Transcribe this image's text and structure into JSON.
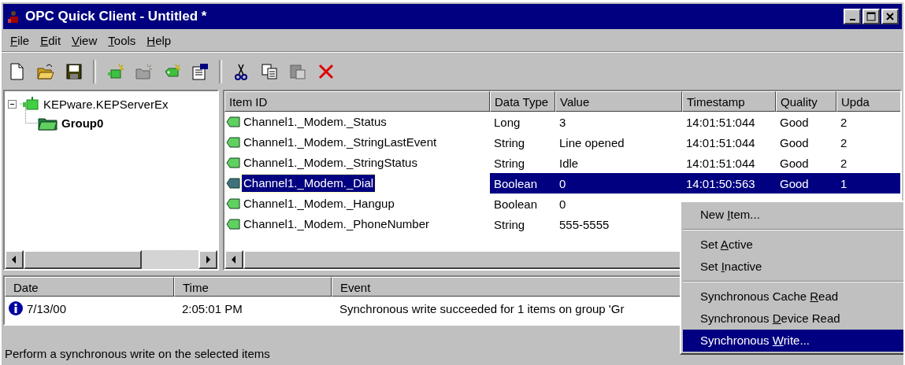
{
  "window": {
    "title": "OPC Quick Client - Untitled *"
  },
  "menu_bar": [
    {
      "key": "F",
      "rest": "ile"
    },
    {
      "key": "E",
      "rest": "dit"
    },
    {
      "key": "V",
      "rest": "iew"
    },
    {
      "key": "T",
      "rest": "ools"
    },
    {
      "key": "H",
      "rest": "elp"
    }
  ],
  "tree": [
    {
      "label": "KEPware.KEPServerEx",
      "expanded": true,
      "selected": false,
      "children": [
        {
          "label": "Group0",
          "selected": true
        }
      ]
    }
  ],
  "item_table": {
    "columns": [
      "Item ID",
      "Data Type",
      "Value",
      "Timestamp",
      "Quality",
      "Upda"
    ],
    "rows": [
      {
        "cells": [
          "Channel1._Modem._Status",
          "Long",
          "3",
          "14:01:51:044",
          "Good",
          "2"
        ],
        "selected": false
      },
      {
        "cells": [
          "Channel1._Modem._StringLastEvent",
          "String",
          "Line opened",
          "14:01:51:044",
          "Good",
          "2"
        ],
        "selected": false
      },
      {
        "cells": [
          "Channel1._Modem._StringStatus",
          "String",
          "Idle",
          "14:01:51:044",
          "Good",
          "2"
        ],
        "selected": false
      },
      {
        "cells": [
          "Channel1._Modem._Dial",
          "Boolean",
          "0",
          "14:01:50:563",
          "Good",
          "1"
        ],
        "selected": true
      },
      {
        "cells": [
          "Channel1._Modem._Hangup",
          "Boolean",
          "0"
        ],
        "selected": false
      },
      {
        "cells": [
          "Channel1._Modem._PhoneNumber",
          "String",
          "555-5555"
        ],
        "selected": false
      }
    ]
  },
  "event_log": {
    "columns": [
      "Date",
      "Time",
      "Event"
    ],
    "rows": [
      {
        "kind": "info",
        "cells": [
          "7/13/00",
          "2:05:01 PM",
          "Synchronous write succeeded for 1 items on group 'Gr"
        ]
      }
    ]
  },
  "status_bar": "Perform a synchronous write on the selected items",
  "context_menu": [
    {
      "kind": "item",
      "pre": "New ",
      "key": "I",
      "rest": "tem...",
      "selected": false
    },
    {
      "kind": "separator"
    },
    {
      "kind": "item",
      "pre": "Set ",
      "key": "A",
      "rest": "ctive",
      "selected": false
    },
    {
      "kind": "item",
      "pre": "Set ",
      "key": "I",
      "rest": "nactive",
      "selected": false
    },
    {
      "kind": "separator"
    },
    {
      "kind": "item",
      "pre": "Synchronous Cache ",
      "key": "R",
      "rest": "ead",
      "selected": false
    },
    {
      "kind": "item",
      "pre": "Synchronous ",
      "key": "D",
      "rest": "evice Read",
      "selected": false
    },
    {
      "kind": "item",
      "pre": "Synchronous ",
      "key": "W",
      "rest": "rite...",
      "selected": true
    }
  ]
}
